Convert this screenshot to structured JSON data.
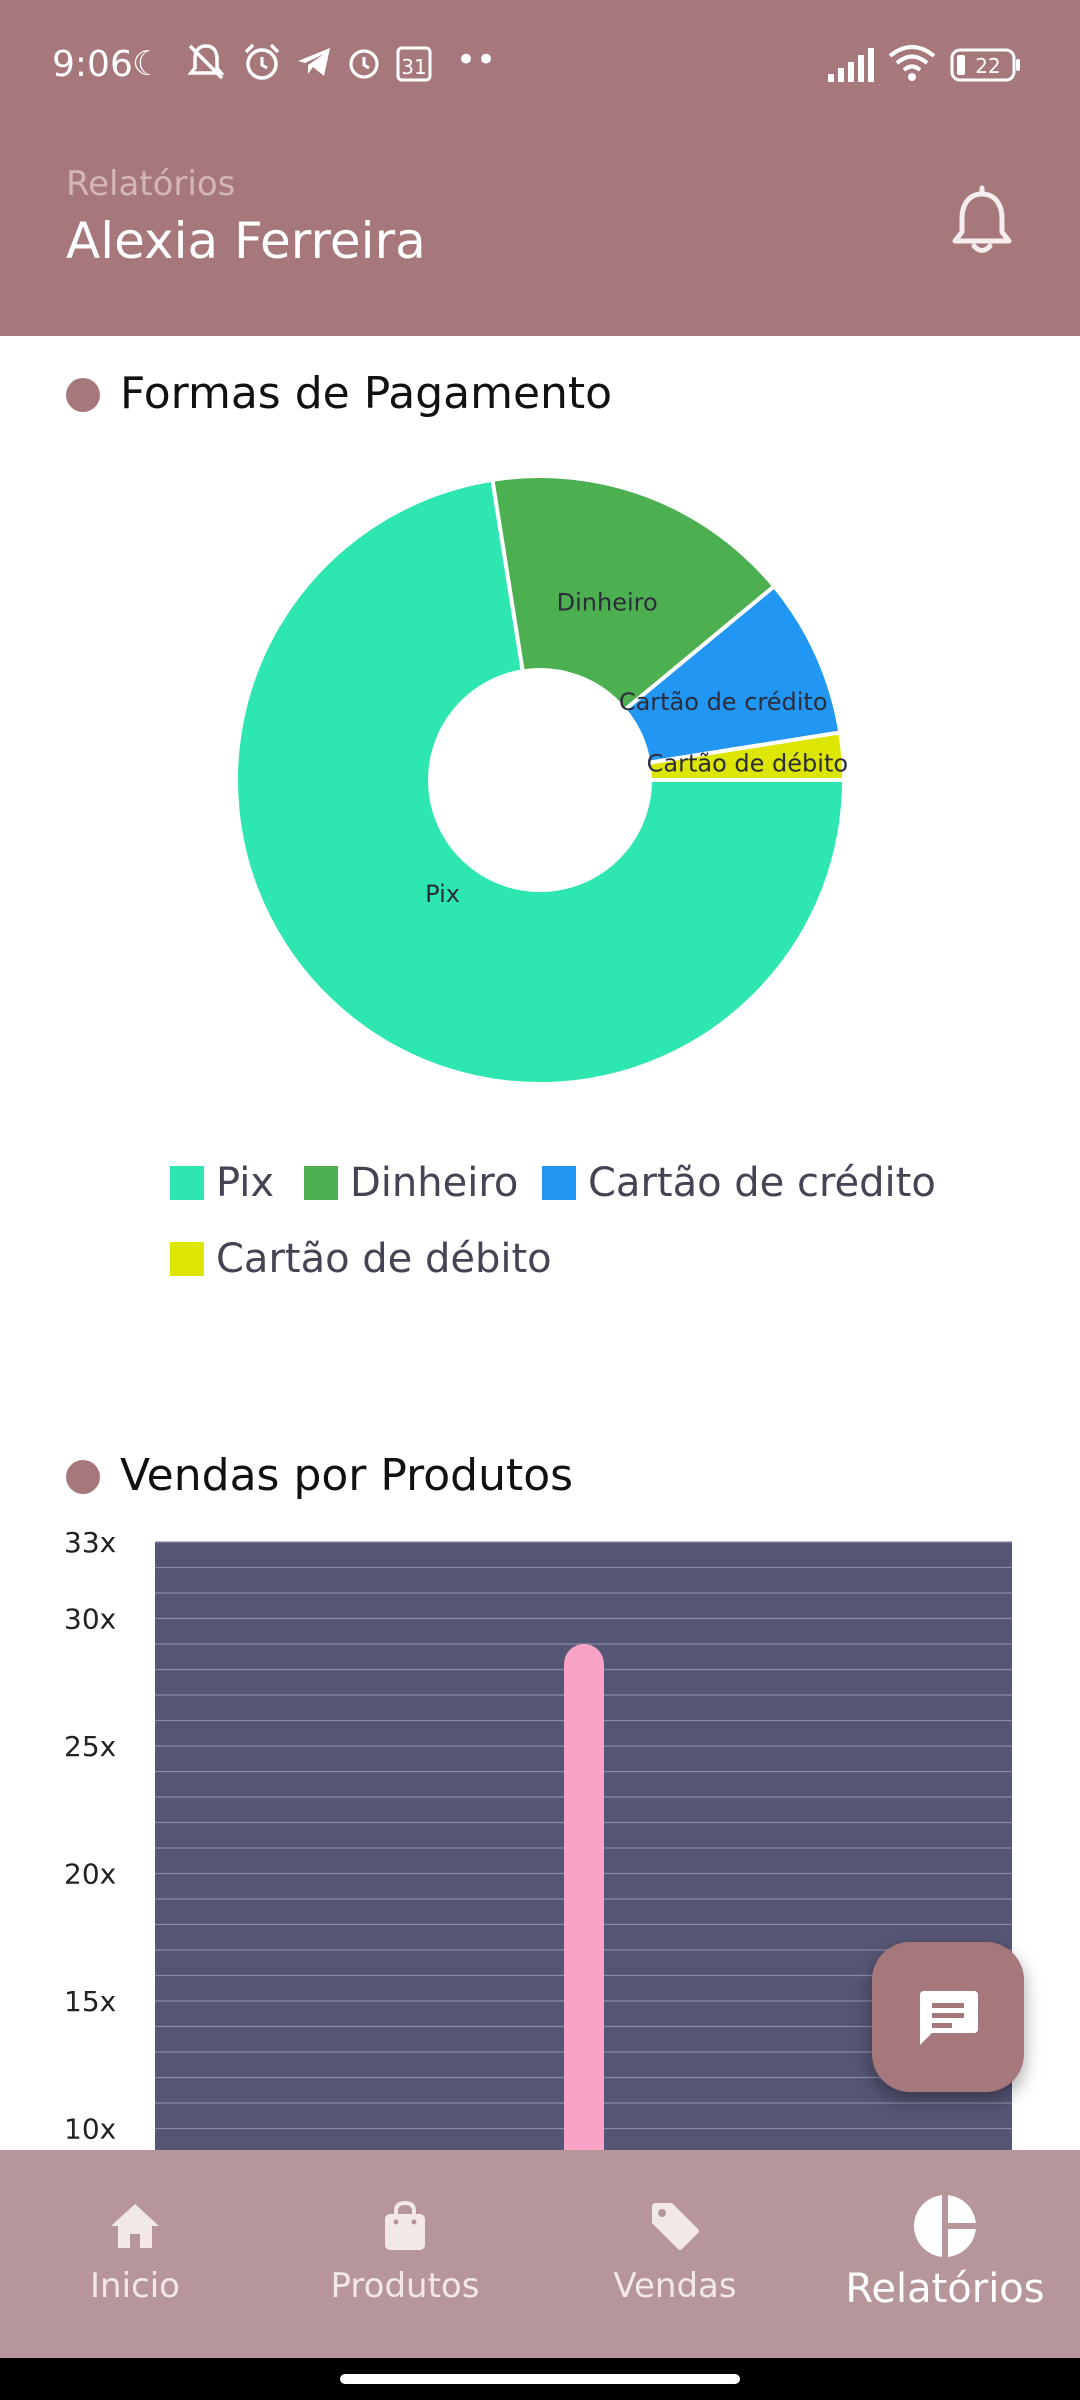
{
  "status_bar": {
    "time": "9:06",
    "calendar_day": "31",
    "battery": "22",
    "dots": "••"
  },
  "header": {
    "subtitle": "Relatórios",
    "title": "Alexia Ferreira"
  },
  "colors": {
    "primary": "#a6777b",
    "pix": "#2ee6b0",
    "dinheiro": "#4caf50",
    "credito": "#2196f3",
    "debito": "#dce600",
    "bar_bg": "#555575",
    "bar": "#f9a3c6"
  },
  "payments": {
    "title": "Formas de Pagamento",
    "legend": [
      "Pix",
      "Dinheiro",
      "Cartão de crédito",
      "Cartão de débito"
    ]
  },
  "sales": {
    "title": "Vendas por Produtos"
  },
  "chart_data": [
    {
      "type": "pie",
      "title": "Formas de Pagamento",
      "donut": true,
      "categories": [
        "Pix",
        "Dinheiro",
        "Cartão de crédito",
        "Cartão de débito"
      ],
      "values": [
        72.5,
        16.5,
        8.5,
        2.5
      ],
      "legend_position": "bottom"
    },
    {
      "type": "bar",
      "title": "Vendas por Produtos",
      "values": [
        29
      ],
      "y_tick_labels": [
        "10x",
        "15x",
        "20x",
        "25x",
        "30x",
        "33x"
      ],
      "ylim": [
        10,
        33
      ],
      "grid": true
    }
  ],
  "nav": {
    "items": [
      {
        "label": "Inicio",
        "icon": "home-icon"
      },
      {
        "label": "Produtos",
        "icon": "shopping-bag-icon"
      },
      {
        "label": "Vendas",
        "icon": "tag-icon"
      },
      {
        "label": "Relatórios",
        "icon": "pie-chart-icon"
      }
    ],
    "active_index": 3
  }
}
